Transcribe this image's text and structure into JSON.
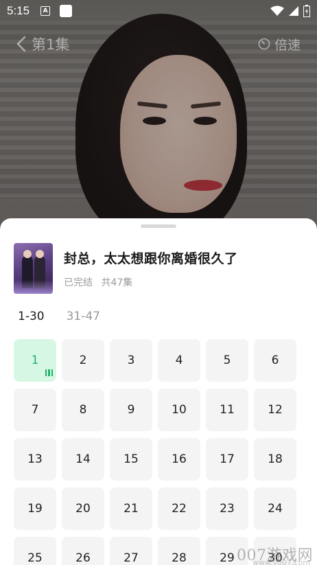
{
  "status_bar": {
    "time": "5:15",
    "notification_icon_letter": "A"
  },
  "nav": {
    "episode_title": "第1集",
    "speed_label": "倍速"
  },
  "drama": {
    "title": "封总，太太想跟你离婚很久了",
    "status": "已完结",
    "episode_count": "共47集"
  },
  "range_tabs": [
    {
      "label": "1-30",
      "active": true
    },
    {
      "label": "31-47",
      "active": false
    }
  ],
  "episodes": [
    "1",
    "2",
    "3",
    "4",
    "5",
    "6",
    "7",
    "8",
    "9",
    "10",
    "11",
    "12",
    "13",
    "14",
    "15",
    "16",
    "17",
    "18",
    "19",
    "20",
    "21",
    "22",
    "23",
    "24",
    "25",
    "26",
    "27",
    "28",
    "29",
    "30"
  ],
  "current_episode": "1",
  "watermark": {
    "text": "007游戏网",
    "url": "www.y007.com"
  },
  "colors": {
    "accent_green": "#22b26a",
    "current_bg": "#d6f7e3",
    "tile_bg": "#f4f4f4"
  }
}
